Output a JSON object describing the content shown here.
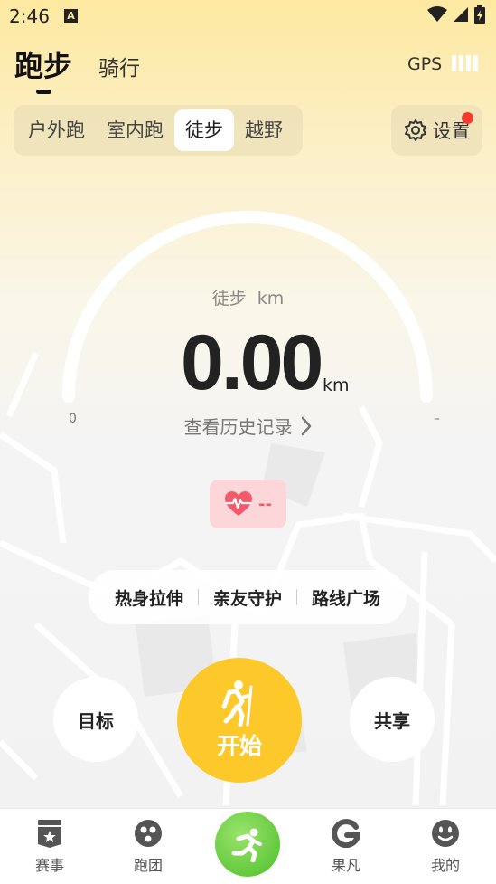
{
  "status_bar": {
    "time": "2:46",
    "notification_icon": "A"
  },
  "header": {
    "tabs": [
      {
        "label": "跑步",
        "active": true
      },
      {
        "label": "骑行",
        "active": false
      }
    ],
    "gps_label": "GPS",
    "gps_signal_bars": 4
  },
  "sub_tabs": [
    {
      "label": "户外跑",
      "active": false
    },
    {
      "label": "室内跑",
      "active": false
    },
    {
      "label": "徒步",
      "active": true
    },
    {
      "label": "越野",
      "active": false
    }
  ],
  "settings": {
    "label": "设置",
    "has_notification_dot": true
  },
  "gauge": {
    "mode_label": "徒步",
    "unit_label": "km",
    "distance": "0.00",
    "distance_unit": "km",
    "min_label": "0",
    "max_label": "–",
    "history_link": "查看历史记录"
  },
  "heart_rate": {
    "value": "--",
    "icon": "heart-pulse-icon"
  },
  "quick_links": [
    "热身拉伸",
    "亲友守护",
    "路线广场"
  ],
  "actions": {
    "goal_label": "目标",
    "start_label": "开始",
    "share_label": "共享"
  },
  "bottom_nav": [
    {
      "label": "赛事",
      "icon": "event-badge-icon"
    },
    {
      "label": "跑团",
      "icon": "group-icon"
    },
    {
      "label": "",
      "icon": "running-man-icon",
      "center": true
    },
    {
      "label": "果凡",
      "icon": "guofan-icon"
    },
    {
      "label": "我的",
      "icon": "smiley-icon"
    }
  ],
  "colors": {
    "accent_yellow": "#fcc82a",
    "nav_green": "#4cbf2a",
    "notification_red": "#f23b2d",
    "heart_pink": "#f25a6b"
  }
}
